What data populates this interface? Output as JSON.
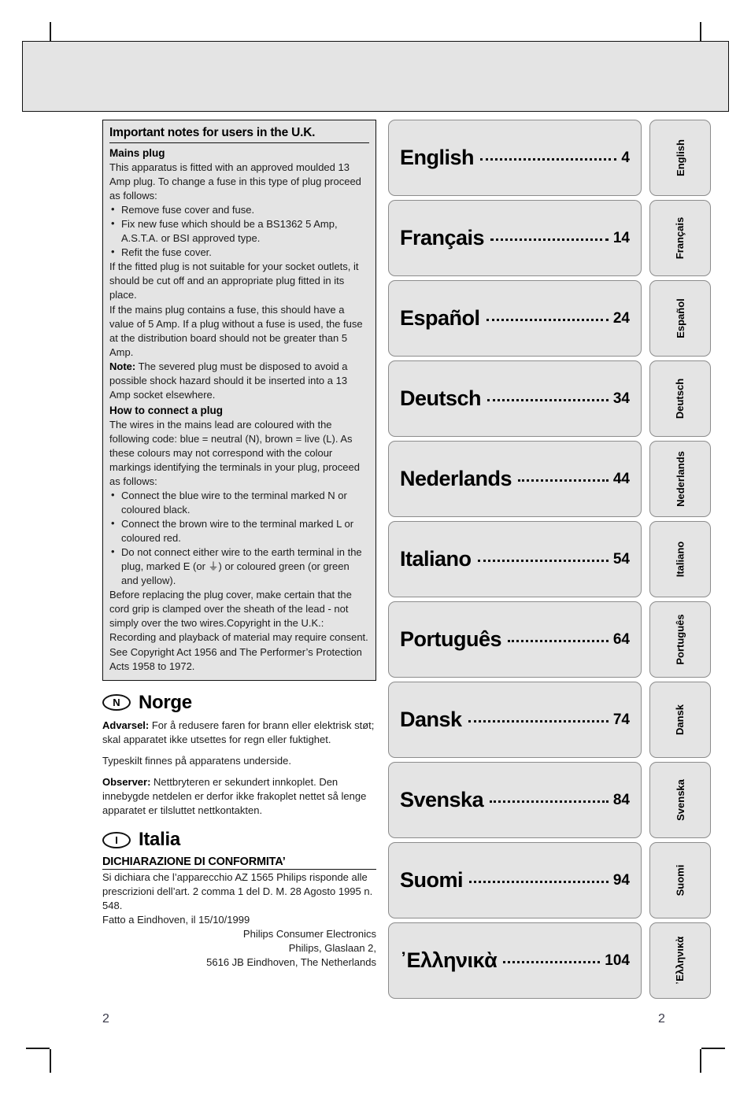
{
  "header_band": {
    "content": ""
  },
  "uk_notes": {
    "title": "Important notes for users in the U.K.",
    "mains_plug_head": "Mains plug",
    "mains_plug_p1": "This apparatus is fitted with an approved moulded 13 Amp plug. To change a fuse in this type of plug proceed as follows:",
    "bullets_1": [
      "Remove fuse cover and fuse.",
      "Fix new fuse which should be a BS1362 5 Amp, A.S.T.A. or BSI approved type.",
      "Refit the fuse cover."
    ],
    "mains_plug_p2": "If the fitted plug is not suitable for your socket outlets, it should be cut off and an appropriate plug fitted in its place.",
    "mains_plug_p3": "If the mains plug contains a fuse, this should have a value of 5 Amp. If a plug without a fuse is used, the fuse at the distribution board should not be greater than 5 Amp.",
    "note_label": "Note:",
    "note_text": " The severed plug must be disposed to avoid a possible shock hazard should it be inserted into a 13 Amp socket elsewhere.",
    "connect_head": "How to connect a plug",
    "connect_p1": "The wires in the mains lead are coloured with the following code: blue = neutral (N), brown = live (L). As these colours may not correspond with the colour markings identifying the terminals in your plug, proceed as follows:",
    "bullets_2": [
      "Connect the blue wire to the terminal marked N or coloured black.",
      "Connect the brown wire to the terminal marked L or coloured red.",
      "Do not connect either wire to the earth terminal in the plug, marked E (or ⏚) or coloured green (or green and yellow)."
    ],
    "connect_p2": "Before replacing the plug cover, make certain that the cord grip is clamped over the sheath of the lead - not simply over the two wires.Copyright in the U.K.: Recording and playback of material may require consent. See Copyright Act 1956 and The Performer’s Protection Acts 1958 to 1972."
  },
  "norge": {
    "symbol": "N",
    "title": "Norge",
    "advarsel_label": "Advarsel:",
    "advarsel_text": " For å redusere faren for brann eller elektrisk støt; skal apparatet ikke utsettes for regn eller fuktighet.",
    "typeskilt": "Typeskilt finnes på apparatens underside.",
    "observer_label": "Observer:",
    "observer_text": " Nettbryteren er sekundert innkoplet. Den innebygde netdelen er derfor ikke frakoplet nettet så lenge apparatet er tilsluttet nettkontakten."
  },
  "italia": {
    "symbol": "I",
    "title": "Italia",
    "conformity_title": "DICHIARAZIONE DI CONFORMITA’",
    "body": "Si dichiara che l’apparecchio AZ 1565 Philips risponde alle prescrizioni dell’art. 2 comma 1 del D. M. 28 Agosto 1995 n. 548.",
    "place_date": "Fatto a Eindhoven, il 15/10/1999",
    "signature_lines": [
      "Philips Consumer Electronics",
      "Philips, Glaslaan 2,",
      "5616 JB Eindhoven, The Netherlands"
    ]
  },
  "language_index": [
    {
      "name": "English",
      "page": "4",
      "tab": "English"
    },
    {
      "name": "Français",
      "page": "14",
      "tab": "Français"
    },
    {
      "name": "Español",
      "page": "24",
      "tab": "Español"
    },
    {
      "name": "Deutsch",
      "page": "34",
      "tab": "Deutsch"
    },
    {
      "name": "Nederlands",
      "page": "44",
      "tab": "Nederlands"
    },
    {
      "name": "Italiano",
      "page": "54",
      "tab": "Italiano"
    },
    {
      "name": "Português",
      "page": "64",
      "tab": "Português"
    },
    {
      "name": "Dansk",
      "page": "74",
      "tab": "Dansk"
    },
    {
      "name": "Svenska",
      "page": "84",
      "tab": "Svenska"
    },
    {
      "name": "Suomi",
      "page": "94",
      "tab": "Suomi"
    },
    {
      "name": "᾿Ελληνικὰ",
      "page": "104",
      "tab": "᾿Ελληνικὰ"
    }
  ],
  "page_number_left": "2",
  "page_number_right": "2",
  "colors": {
    "panel_fill": "#e4e4e4",
    "panel_border": "#111111",
    "tab_border": "#8c8c8c",
    "text": "#1b1b1b"
  }
}
